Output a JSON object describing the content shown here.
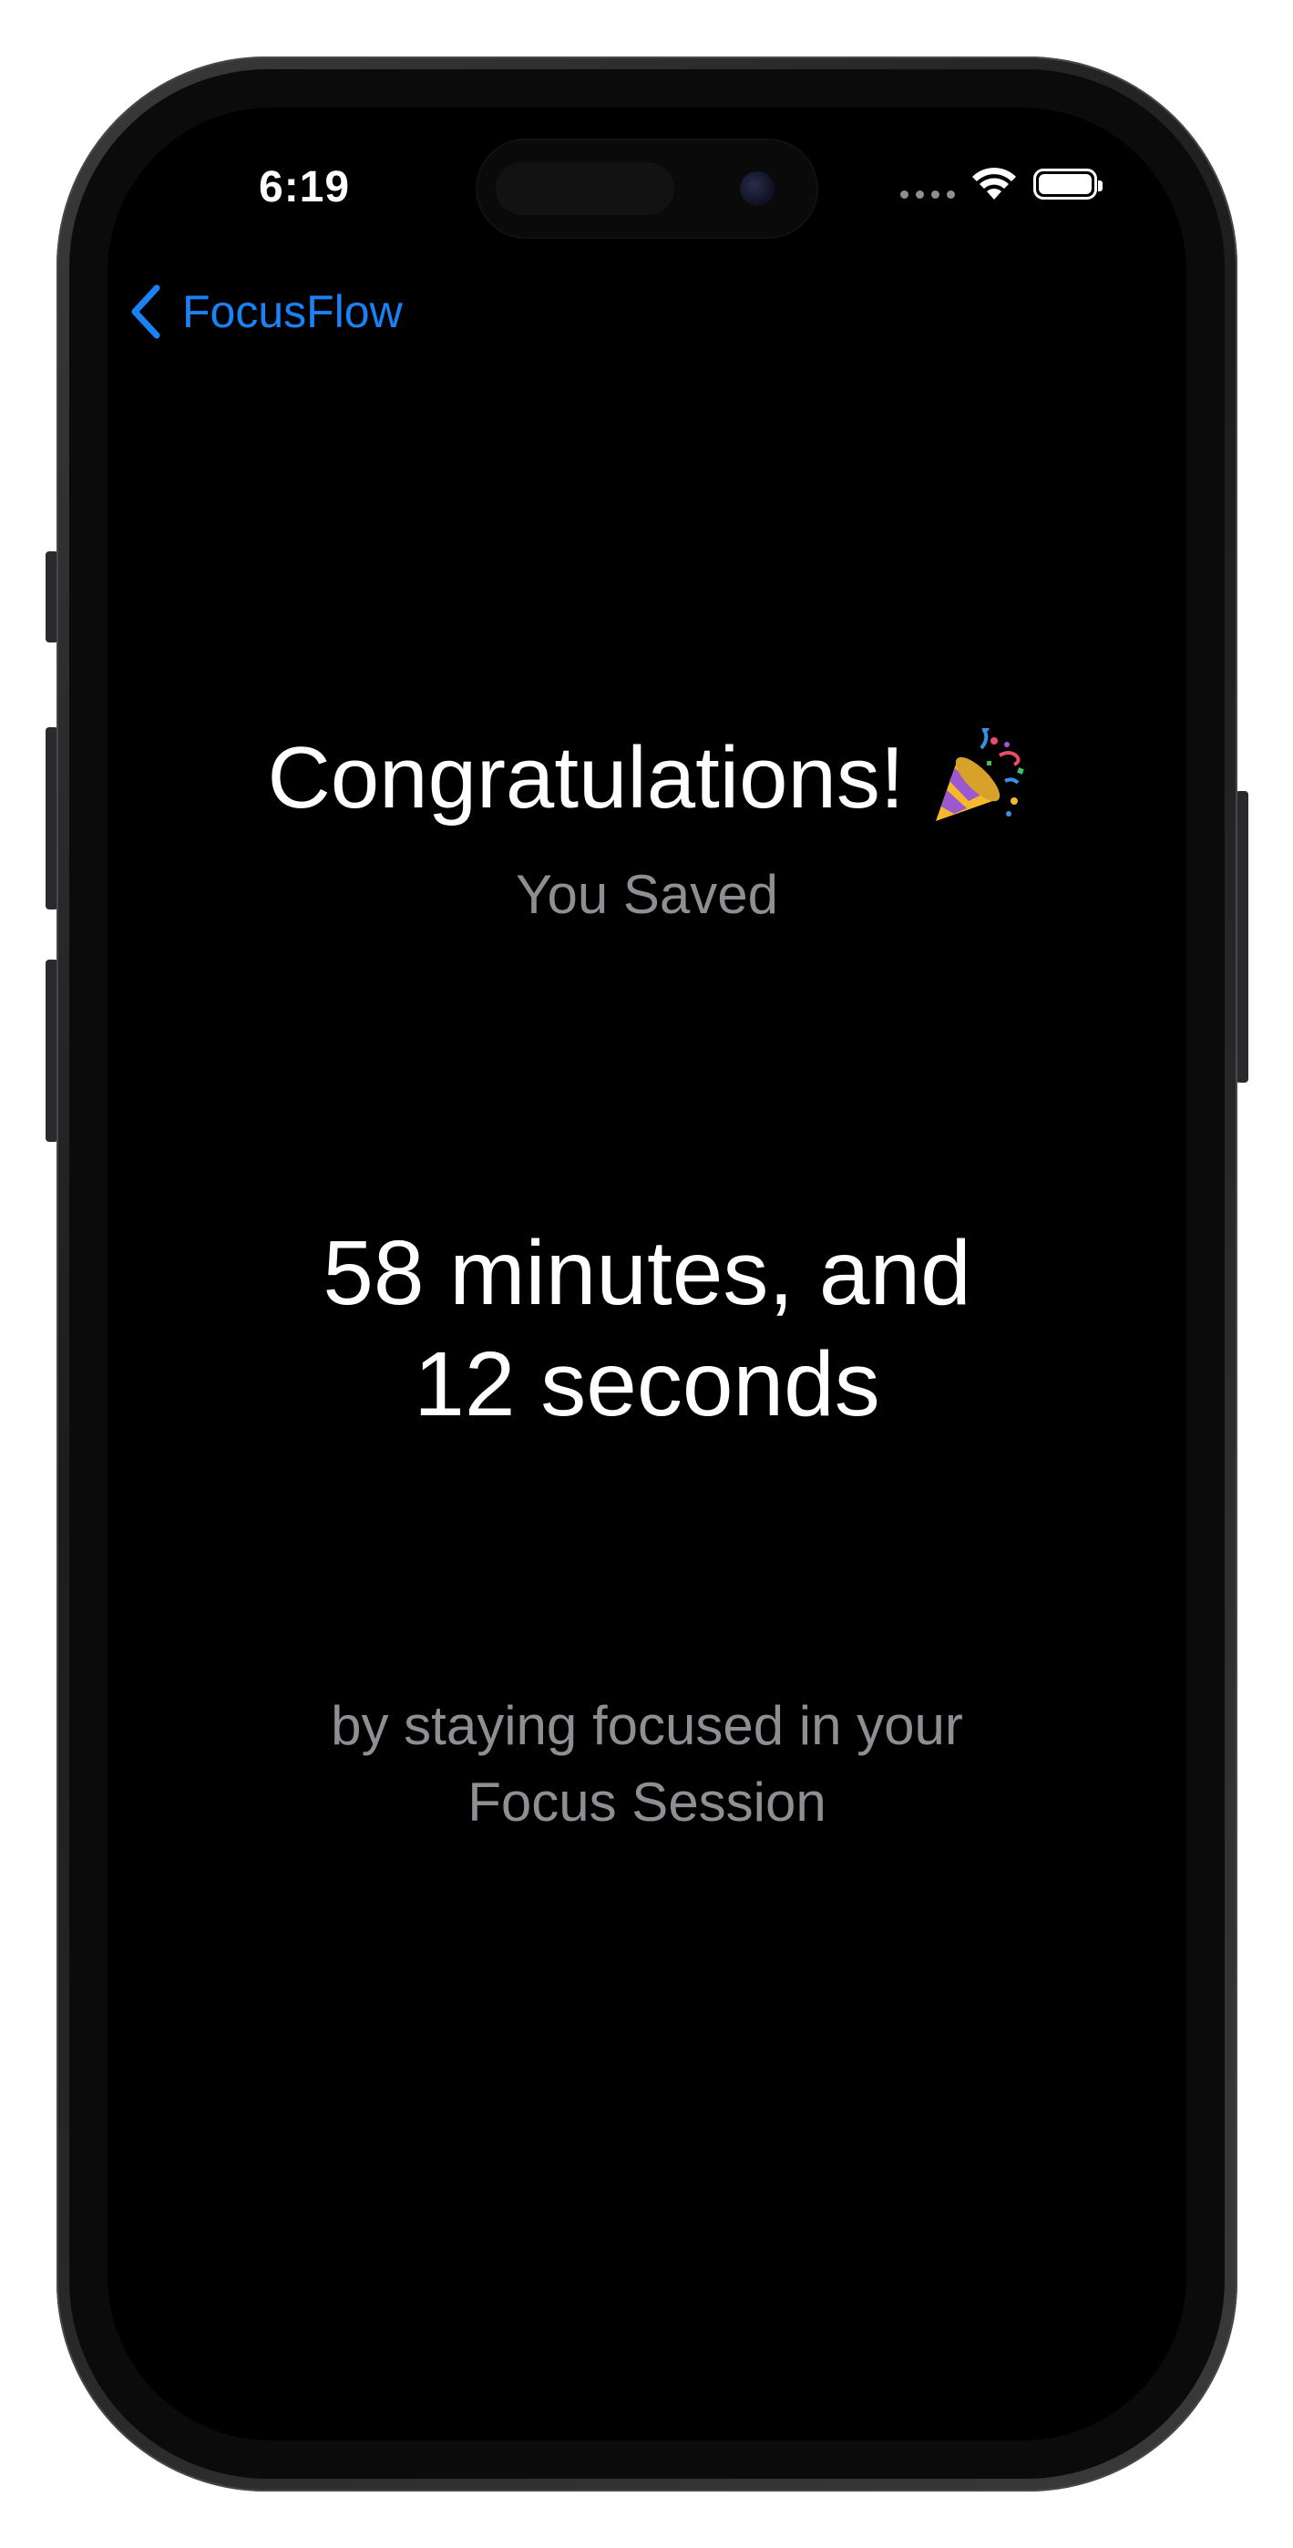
{
  "status_bar": {
    "time": "6:19",
    "wifi_icon": "wifi-icon",
    "battery_icon": "battery-full-icon"
  },
  "nav": {
    "back_label": "FocusFlow",
    "back_icon": "chevron-left-icon",
    "accent_color": "#1a82f7"
  },
  "main": {
    "title": "Congratulations!",
    "title_icon": "party-popper-icon",
    "subtitle": "You Saved",
    "saved_time": "58 minutes, and 12 seconds",
    "caption": "by staying focused in your Focus Session"
  },
  "colors": {
    "background": "#000000",
    "primary_text": "#ffffff",
    "secondary_text": "#8e8e93"
  }
}
